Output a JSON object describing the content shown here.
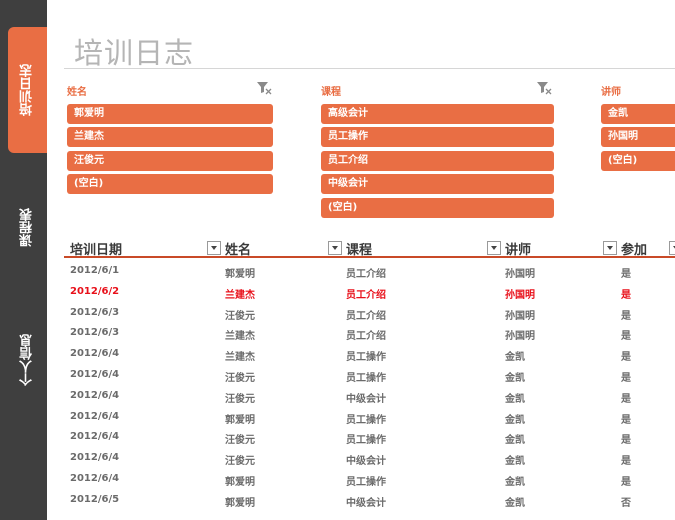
{
  "sheet_tabs": [
    {
      "label": "培训日志",
      "active": true
    },
    {
      "label": "课程表",
      "active": false
    },
    {
      "label": "个人信息",
      "active": false
    }
  ],
  "title": "培训日志",
  "slicers": {
    "name": {
      "label": "姓名",
      "items": [
        "郭爱明",
        "兰建杰",
        "汪俊元",
        "(空白)"
      ]
    },
    "course": {
      "label": "课程",
      "items": [
        "高级会计",
        "员工操作",
        "员工介绍",
        "中级会计",
        "(空白)"
      ]
    },
    "lecturer": {
      "label": "讲师",
      "items": [
        "金凯",
        "孙国明",
        "(空白)"
      ]
    }
  },
  "table": {
    "headers": {
      "date": "培训日期",
      "name": "姓名",
      "course": "课程",
      "lecturer": "讲师",
      "attend": "参加"
    },
    "rows": [
      [
        "2012/6/1",
        "郭爱明",
        "员工介绍",
        "孙国明",
        "是"
      ],
      [
        "2012/6/2",
        "兰建杰",
        "员工介绍",
        "孙国明",
        "是"
      ],
      [
        "2012/6/3",
        "汪俊元",
        "员工介绍",
        "孙国明",
        "是"
      ],
      [
        "2012/6/3",
        "兰建杰",
        "员工介绍",
        "孙国明",
        "是"
      ],
      [
        "2012/6/4",
        "兰建杰",
        "员工操作",
        "金凯",
        "是"
      ],
      [
        "2012/6/4",
        "汪俊元",
        "员工操作",
        "金凯",
        "是"
      ],
      [
        "2012/6/4",
        "汪俊元",
        "中级会计",
        "金凯",
        "是"
      ],
      [
        "2012/6/4",
        "郭爱明",
        "员工操作",
        "金凯",
        "是"
      ],
      [
        "2012/6/4",
        "汪俊元",
        "员工操作",
        "金凯",
        "是"
      ],
      [
        "2012/6/4",
        "汪俊元",
        "中级会计",
        "金凯",
        "是"
      ],
      [
        "2012/6/4",
        "郭爱明",
        "员工操作",
        "金凯",
        "是"
      ],
      [
        "2012/6/5",
        "郭爱明",
        "中级会计",
        "金凯",
        "否"
      ]
    ],
    "highlighted_row_index": 1
  },
  "colors": {
    "accent": "#e96e44",
    "rail": "#3f3f3f",
    "highlight_text": "#e8101a",
    "title": "#b5b5b5"
  }
}
